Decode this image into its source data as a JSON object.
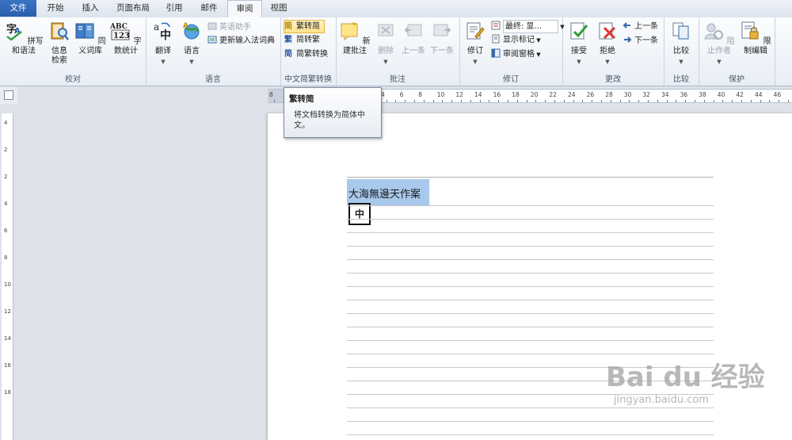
{
  "tabs": [
    "文件",
    "开始",
    "插入",
    "页面布局",
    "引用",
    "邮件",
    "审阅",
    "视图"
  ],
  "active_tab": "审阅",
  "groups": {
    "proofing": {
      "label": "校对",
      "spelling": "拼写和语法",
      "research_1": "信息",
      "research_2": "检索",
      "thesaurus": "同义词库",
      "wordcount": "字数统计"
    },
    "language": {
      "label": "语言",
      "translate": "翻译",
      "language": "语言",
      "english_assistant": "英语助手",
      "update_ime": "更新输入法词典"
    },
    "chinese": {
      "label": "中文简繁转换",
      "to_simplified": "繁转简",
      "to_traditional": "简转繁",
      "convert": "简繁转换"
    },
    "comments": {
      "label": "批注",
      "new_comment": "新建批注",
      "delete": "删除",
      "prev": "上一条",
      "next": "下一条"
    },
    "tracking": {
      "label": "修订",
      "track": "修订",
      "display_markup": "最终: 显...",
      "show_markup": "显示标记",
      "reviewing_pane": "审阅窗格"
    },
    "changes": {
      "label": "更改",
      "accept": "接受",
      "reject": "拒绝",
      "previous": "上一条",
      "next": "下一条"
    },
    "compare": {
      "label": "比较",
      "compare": "比较"
    },
    "protect": {
      "label": "保护",
      "block_authors": "阻止作者",
      "restrict_editing": "限制编辑"
    }
  },
  "ruler": {
    "h_ticks": [
      "8",
      "4",
      "6",
      "8",
      "10",
      "12",
      "14",
      "16",
      "18",
      "20",
      "22",
      "24",
      "26",
      "28",
      "30",
      "32",
      "34",
      "36",
      "38",
      "40",
      "42",
      "44",
      "46"
    ],
    "v_ticks": [
      "4",
      "2",
      "2",
      "4",
      "6",
      "8",
      "10",
      "12",
      "14",
      "16",
      "18"
    ]
  },
  "tooltip": {
    "title": "繁转简",
    "description": "将文档转换为简体中文。"
  },
  "document": {
    "selected_text": "大海無邊天作案",
    "ime_indicator": "中"
  },
  "watermark": {
    "logo": "Bai du 经验",
    "url": "jingyan.baidu.com"
  }
}
